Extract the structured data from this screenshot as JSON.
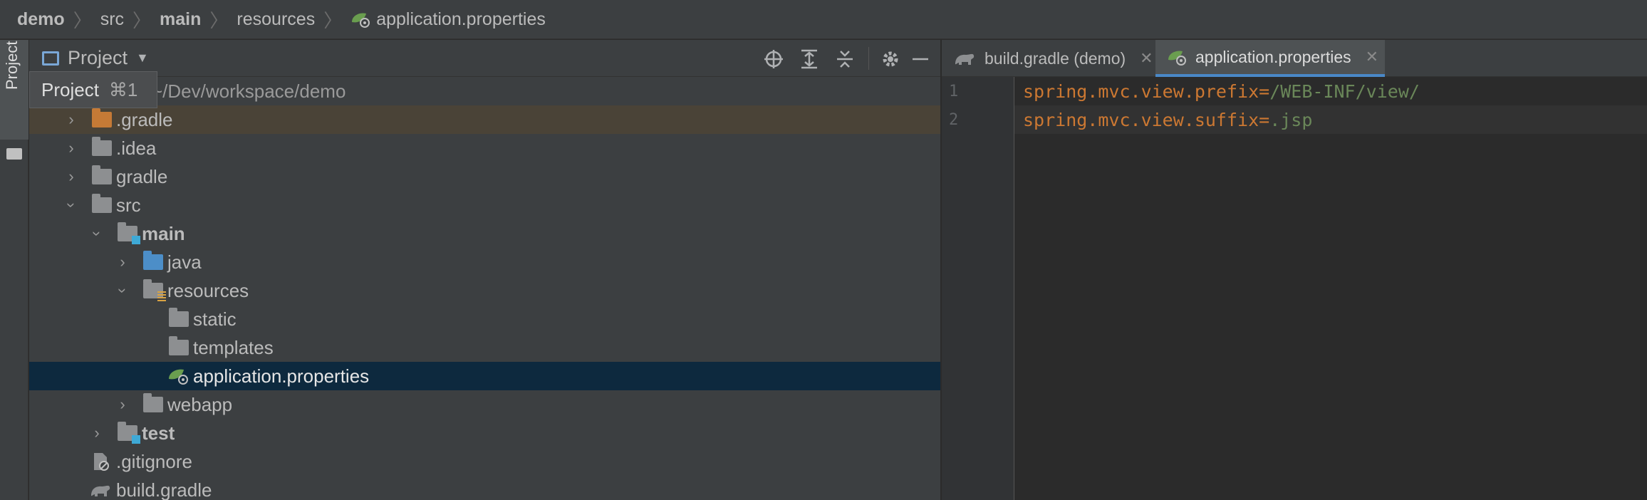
{
  "breadcrumb": {
    "items": [
      "demo",
      "src",
      "main",
      "resources"
    ],
    "file": "application.properties"
  },
  "stripe": {
    "label": "Project"
  },
  "project_panel": {
    "title": "Project",
    "root_path": "~/Dev/workspace/demo",
    "tooltip": {
      "label": "Project",
      "shortcut": "⌘1"
    },
    "tree": [
      {
        "label": ".gradle",
        "expand": "collapsed",
        "icon": "folder-orange-icon"
      },
      {
        "label": ".idea",
        "expand": "collapsed",
        "icon": "folder-icon"
      },
      {
        "label": "gradle",
        "expand": "collapsed",
        "icon": "folder-icon"
      },
      {
        "label": "src",
        "expand": "expanded",
        "icon": "folder-icon"
      },
      {
        "label": "main",
        "expand": "expanded",
        "icon": "source-root-folder-icon",
        "bold": true
      },
      {
        "label": "java",
        "expand": "collapsed",
        "icon": "folder-blue-icon"
      },
      {
        "label": "resources",
        "expand": "expanded",
        "icon": "resources-folder-icon"
      },
      {
        "label": "static",
        "expand": "none",
        "icon": "folder-icon"
      },
      {
        "label": "templates",
        "expand": "none",
        "icon": "folder-icon"
      },
      {
        "label": "application.properties",
        "expand": "none",
        "icon": "spring-properties-icon",
        "selected": true
      },
      {
        "label": "webapp",
        "expand": "collapsed",
        "icon": "folder-icon"
      },
      {
        "label": "test",
        "expand": "collapsed",
        "icon": "test-folder-icon",
        "bold": true
      },
      {
        "label": ".gitignore",
        "expand": "none",
        "icon": "ignore-file-icon"
      },
      {
        "label": "build.gradle",
        "expand": "none",
        "icon": "gradle-icon"
      }
    ]
  },
  "editor": {
    "tabs": [
      {
        "label": "build.gradle (demo)",
        "active": false
      },
      {
        "label": "application.properties",
        "active": true
      }
    ],
    "lines": [
      {
        "num": "1",
        "key": "spring.mvc.view.prefix",
        "eq": "=",
        "value": "/WEB-INF/view/"
      },
      {
        "num": "2",
        "key": "spring.mvc.view.suffix",
        "eq": "=",
        "value": ".jsp"
      }
    ]
  },
  "colors": {
    "key": "#cc7832",
    "value": "#6a8759",
    "selection": "#0d293e",
    "accent": "#4a88c7"
  }
}
